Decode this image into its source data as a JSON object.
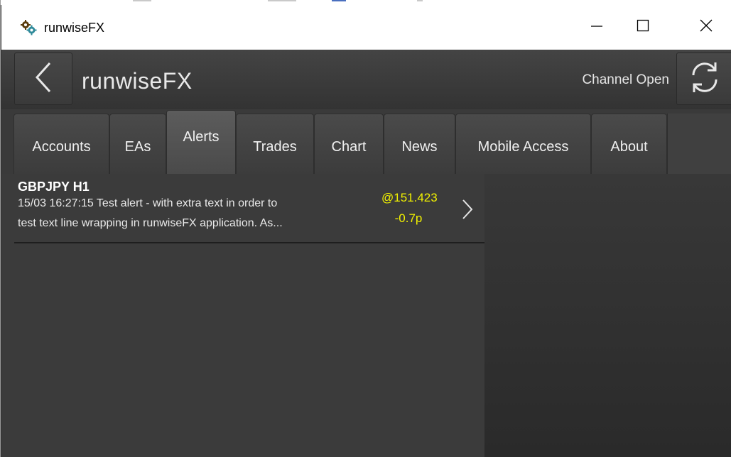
{
  "window": {
    "title": "runwiseFX",
    "icon": "gears-icon",
    "controls": {
      "minimize": "minimize-icon",
      "maximize": "maximize-icon",
      "close": "close-icon"
    }
  },
  "header": {
    "back_icon": "chevron-left-icon",
    "title": "runwiseFX",
    "channel_status": "Channel Open",
    "refresh_icon": "refresh-icon"
  },
  "tabs": [
    {
      "label": "Accounts",
      "active": false
    },
    {
      "label": "EAs",
      "active": false
    },
    {
      "label": "Alerts",
      "active": true
    },
    {
      "label": "Trades",
      "active": false
    },
    {
      "label": "Chart",
      "active": false
    },
    {
      "label": "News",
      "active": false
    },
    {
      "label": "Mobile Access",
      "active": false
    },
    {
      "label": "About",
      "active": false
    }
  ],
  "alerts": [
    {
      "symbol": "GBPJPY H1",
      "message_line1": "15/03 16:27:15 Test alert - with extra text in order to",
      "message_line2": "test text line wrapping in runwiseFX application. As...",
      "price": "@151.423",
      "pips": "-0.7p",
      "chevron_icon": "chevron-right-icon"
    }
  ],
  "colors": {
    "accent_yellow": "#f2f200",
    "background": "#333333",
    "text": "#eaeaea"
  }
}
